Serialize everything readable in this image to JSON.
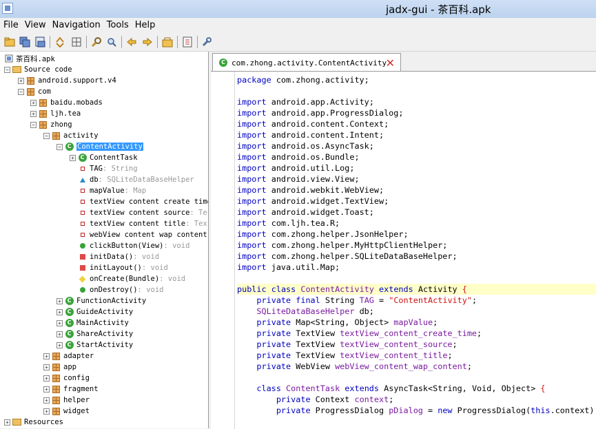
{
  "window": {
    "title": "jadx-gui - 茶百科.apk"
  },
  "menu": [
    "File",
    "View",
    "Navigation",
    "Tools",
    "Help"
  ],
  "toolbar_icons": [
    "open-file-icon",
    "save-all-icon",
    "export-icon",
    "sync-icon",
    "flatten-icon",
    "search-text-icon",
    "search-class-icon",
    "back-icon",
    "forward-icon",
    "decompile-icon",
    "log-icon",
    "preferences-icon"
  ],
  "tree": {
    "root": "茶百科.apk",
    "source_code": "Source code",
    "android_support": "android.support.v4",
    "com": "com",
    "baidu": "baidu.mobads",
    "ljh": "ljh.tea",
    "zhong": "zhong",
    "activity": "activity",
    "content_activity": "ContentActivity",
    "content_task": "ContentTask",
    "tag": "TAG",
    "tag_type": " : String",
    "db": "db",
    "db_type": " : SQLiteDataBaseHelper",
    "map_value": "mapValue",
    "map_type": " : Map",
    "tv_time": "textView content create time",
    "tv_source": "textView content source",
    "tv_source_type": " : Te",
    "tv_title": "textView content title",
    "tv_title_type": " : Tex",
    "wv": "webView content wap content",
    "click": "clickButton(View)",
    "init_data": "initData()",
    "init_layout": "initLayout()",
    "on_create": "onCreate(Bundle)",
    "on_destroy": "onDestroy()",
    "void_type": " : void",
    "function_activity": "FunctionActivity",
    "guide_activity": "GuideActivity",
    "main_activity": "MainActivity",
    "share_activity": "ShareActivity",
    "start_activity": "StartActivity",
    "adapter": "adapter",
    "app": "app",
    "config": "config",
    "fragment": "fragment",
    "helper": "helper",
    "widget": "widget",
    "resources": "Resources"
  },
  "tab": {
    "label": "com.zhong.activity.ContentActivity"
  },
  "code": {
    "l1a": "package",
    "l1b": " com.zhong.activity;",
    "imp": "import",
    "i1": " android.app.Activity;",
    "i2": " android.app.ProgressDialog;",
    "i3": " android.content.Context;",
    "i4": " android.content.Intent;",
    "i5": " android.os.AsyncTask;",
    "i6": " android.os.Bundle;",
    "i7": " android.util.Log;",
    "i8": " android.view.View;",
    "i9": " android.webkit.WebView;",
    "i10": " android.widget.TextView;",
    "i11": " android.widget.Toast;",
    "i12": " com.ljh.tea.R;",
    "i13": " com.zhong.helper.JsonHelper;",
    "i14": " com.zhong.helper.MyHttpClientHelper;",
    "i15": " com.zhong.helper.SQLiteDataBaseHelper;",
    "i16": " java.util.Map;",
    "c_public": "public",
    "c_class": "class",
    "c_name": "ContentActivity",
    "c_extends": "extends",
    "c_super": "Activity",
    "c_brace": " {",
    "f1_mod": "private final",
    "f1_type": " String ",
    "f1_name": "TAG",
    "f1_eq": " = ",
    "f1_val": "\"ContentActivity\"",
    "semi": ";",
    "f2_type": "SQLiteDataBaseHelper",
    "f2_name": " db;",
    "priv": "private",
    "f3_type": " Map<String, Object> ",
    "f3_name": "mapValue",
    "tv": " TextView ",
    "f4_name": "textView_content_create_time",
    "f5_name": "textView_content_source",
    "f6_name": "textView_content_title",
    "wvt": " WebView ",
    "f7_name": "webView_content_wap_content",
    "t_class": "class",
    "t_name": "ContentTask",
    "t_extends": "extends",
    "t_super": " AsyncTask<String, Void, Object> ",
    "t_brace": "{",
    "t1_type": " Context ",
    "t1_name": "context",
    "t2_type": " ProgressDialog ",
    "t2_name": "pDialog",
    "t2_eq": " = ",
    "t2_new": "new",
    "t2_cls": " ProgressDialog(",
    "t2_this": "this",
    "t2_end": ".context);"
  }
}
